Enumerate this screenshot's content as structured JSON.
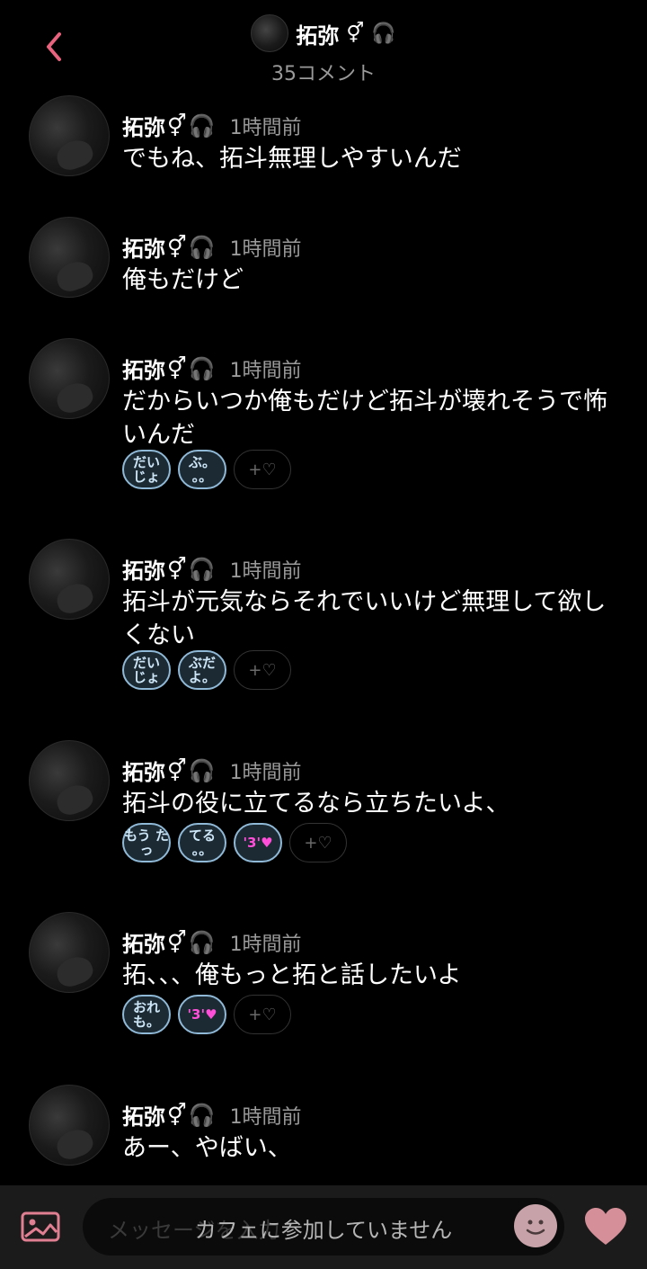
{
  "header": {
    "name": "拓弥",
    "comment_count": "35コメント"
  },
  "colors": {
    "accent": "#e8637e",
    "reaction_border": "#8fb9d6",
    "pink_text": "#ff4fd8"
  },
  "comments": [
    {
      "name": "拓弥",
      "time": "1時間前",
      "text": "でもね、拓斗無理しやすいんだ",
      "reactions": []
    },
    {
      "name": "拓弥",
      "time": "1時間前",
      "text": "俺もだけど",
      "reactions": []
    },
    {
      "name": "拓弥",
      "time": "1時間前",
      "text": "だからいつか俺もだけど拓斗が壊れそうで怖いんだ",
      "reactions": [
        {
          "label": "だい じょ",
          "color": "blue"
        },
        {
          "label": "ぶ。 。。",
          "color": "blue"
        }
      ],
      "add_label": "+♡"
    },
    {
      "name": "拓弥",
      "time": "1時間前",
      "text": "拓斗が元気ならそれでいいけど無理して欲しくない",
      "reactions": [
        {
          "label": "だい じょ",
          "color": "blue"
        },
        {
          "label": "ぶだ よ。",
          "color": "blue"
        }
      ],
      "add_label": "+♡"
    },
    {
      "name": "拓弥",
      "time": "1時間前",
      "text": "拓斗の役に立てるなら立ちたいよ、",
      "reactions": [
        {
          "label": "もう たっ",
          "color": "blue"
        },
        {
          "label": "てる 。。",
          "color": "blue"
        },
        {
          "label": "'3'♥",
          "color": "pink"
        }
      ],
      "add_label": "+♡"
    },
    {
      "name": "拓弥",
      "time": "1時間前",
      "text": "拓、、、俺もっと拓と話したいよ",
      "reactions": [
        {
          "label": "おれ も。",
          "color": "blue"
        },
        {
          "label": "'3'♥",
          "color": "pink"
        }
      ],
      "add_label": "+♡"
    },
    {
      "name": "拓弥",
      "time": "1時間前",
      "text": "あー、やばい、",
      "reactions": []
    }
  ],
  "footer": {
    "placeholder": "メッセージを入力",
    "notice": "カフェに参加していません"
  }
}
